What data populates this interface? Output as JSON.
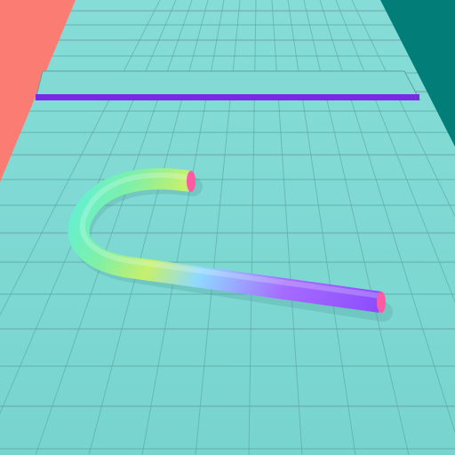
{
  "scene": {
    "type": "3d-runner-game-view",
    "colors": {
      "floor": "#7fd8d2",
      "tile_lines": "#5aa4a0",
      "tile_shadow": "#a3a6c9",
      "left_wall": "#fa7c72",
      "right_wall": "#037d78",
      "barrier_bar": "#7a2ae6",
      "rope_gradient": [
        "#6de9ff",
        "#7ff0a6",
        "#c7f06c",
        "#a66cff",
        "#7b4dff"
      ],
      "rope_end_caps": "#ff5aa2"
    },
    "objects": [
      {
        "name": "left-wall",
        "icon": "wall"
      },
      {
        "name": "right-wall",
        "icon": "wall"
      },
      {
        "name": "barrier-bar",
        "icon": "bar-obstacle"
      },
      {
        "name": "rope-player",
        "icon": "curved-tube"
      }
    ]
  }
}
